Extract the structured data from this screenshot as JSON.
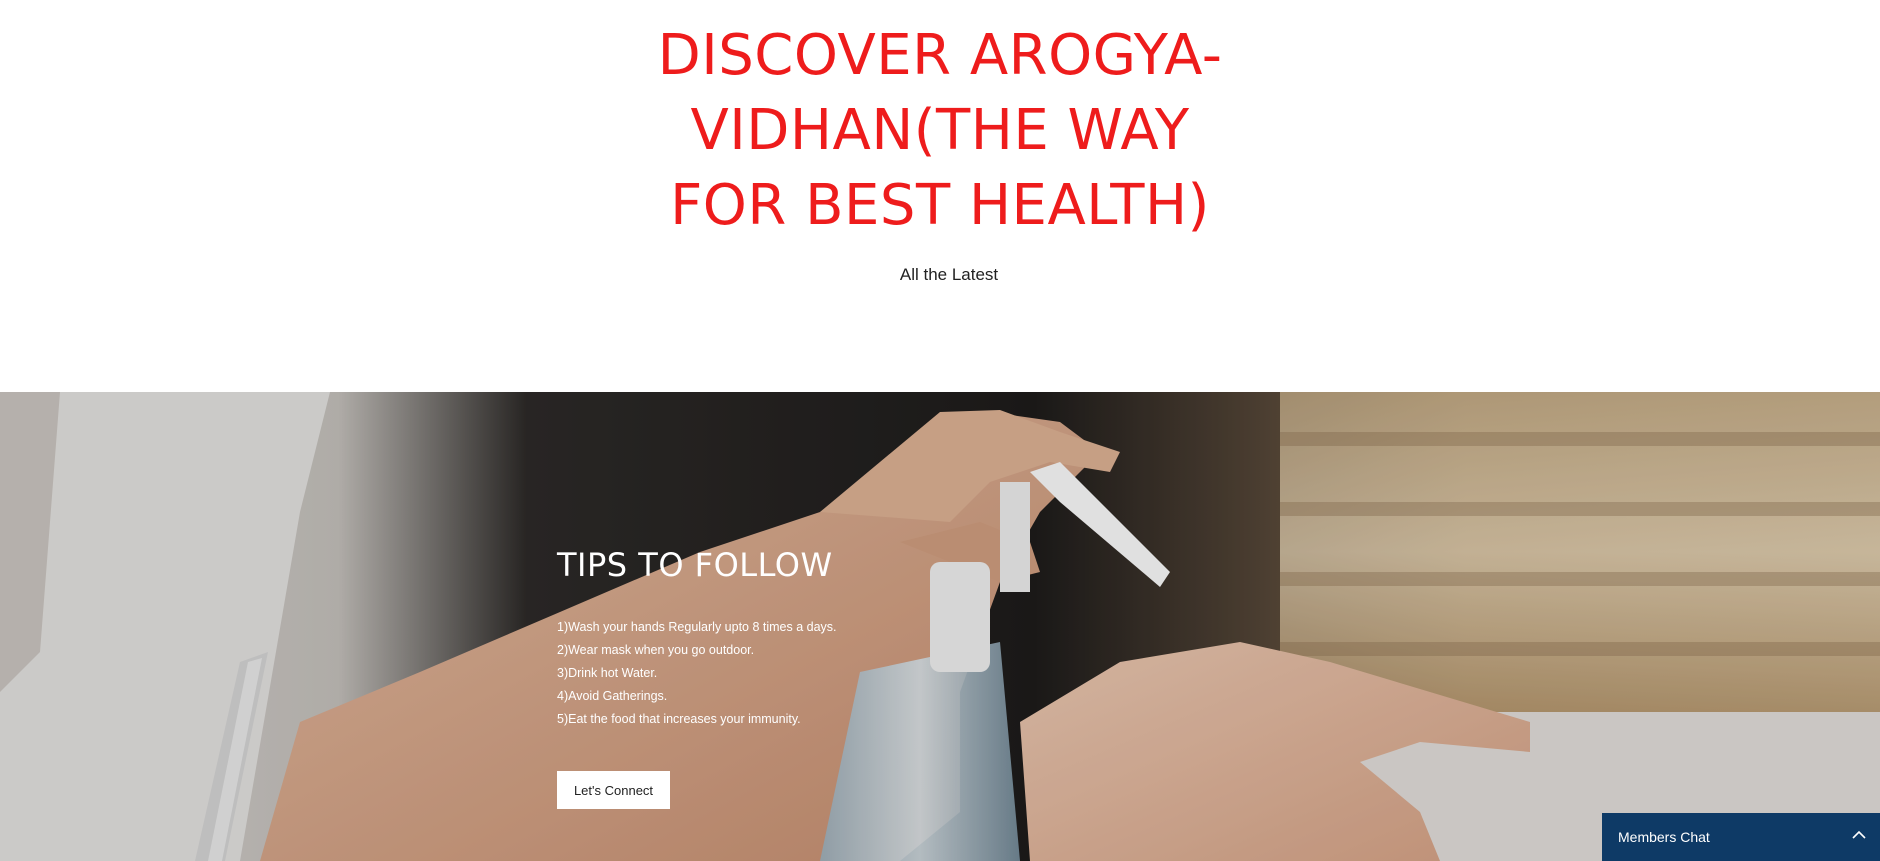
{
  "hero": {
    "title": "DISCOVER AROGYA-\nVIDHAN(THE WAY\nFOR BEST HEALTH)",
    "subtitle": "All the Latest"
  },
  "tips": {
    "title": "TIPS TO FOLLOW",
    "items": [
      "1)Wash your hands Regularly upto 8 times a days.",
      "2)Wear mask when you go outdoor.",
      "3)Drink hot Water.",
      "4)Avoid Gatherings.",
      "5)Eat the food that increases your immunity."
    ],
    "button_label": "Let's Connect"
  },
  "members_chat": {
    "label": "Members Chat",
    "icon": "chevron-up-icon"
  },
  "colors": {
    "accent_line": "#9b2a8f",
    "title_red": "#ee1c1c",
    "chat_bar": "#0e3a66"
  }
}
